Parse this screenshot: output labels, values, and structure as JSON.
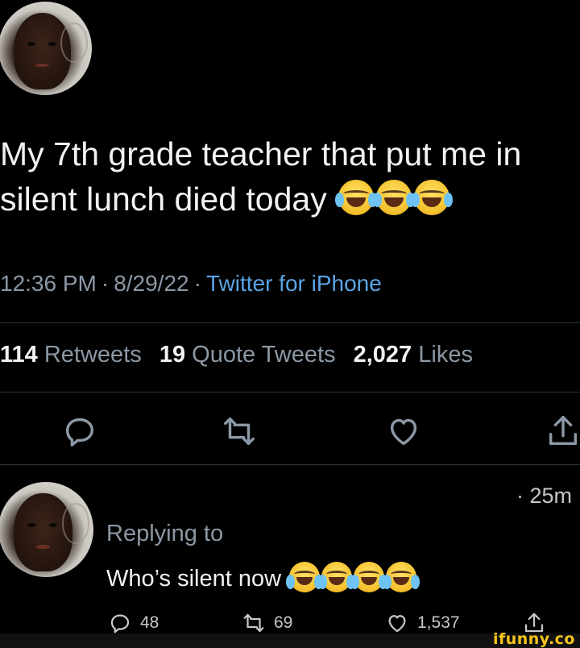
{
  "tweet": {
    "text_line1": "My 7th grade teacher that put me in",
    "text_line2": "silent lunch died today",
    "emoji_count": 3,
    "time": "12:36 PM",
    "date": "8/29/22",
    "source": "Twitter for iPhone",
    "dot": "·"
  },
  "stats": {
    "retweets_count": "114",
    "retweets_label": "Retweets",
    "quotes_count": "19",
    "quotes_label": "Quote Tweets",
    "likes_count": "2,027",
    "likes_label": "Likes"
  },
  "actions": {
    "icons": [
      "reply-icon",
      "retweet-icon",
      "like-icon",
      "share-icon"
    ]
  },
  "reply": {
    "time": "· 25m",
    "replying_to": "Replying to",
    "text": "Who’s silent now",
    "emoji_count": 4,
    "reply_count": "48",
    "retweet_count": "69",
    "like_count": "1,537"
  },
  "watermark": "ifunny.co",
  "colors": {
    "background": "#000000",
    "text": "#f2f2f2",
    "secondary": "#8b98a5",
    "link": "#5ba4e5",
    "watermark": "#f5c518"
  }
}
